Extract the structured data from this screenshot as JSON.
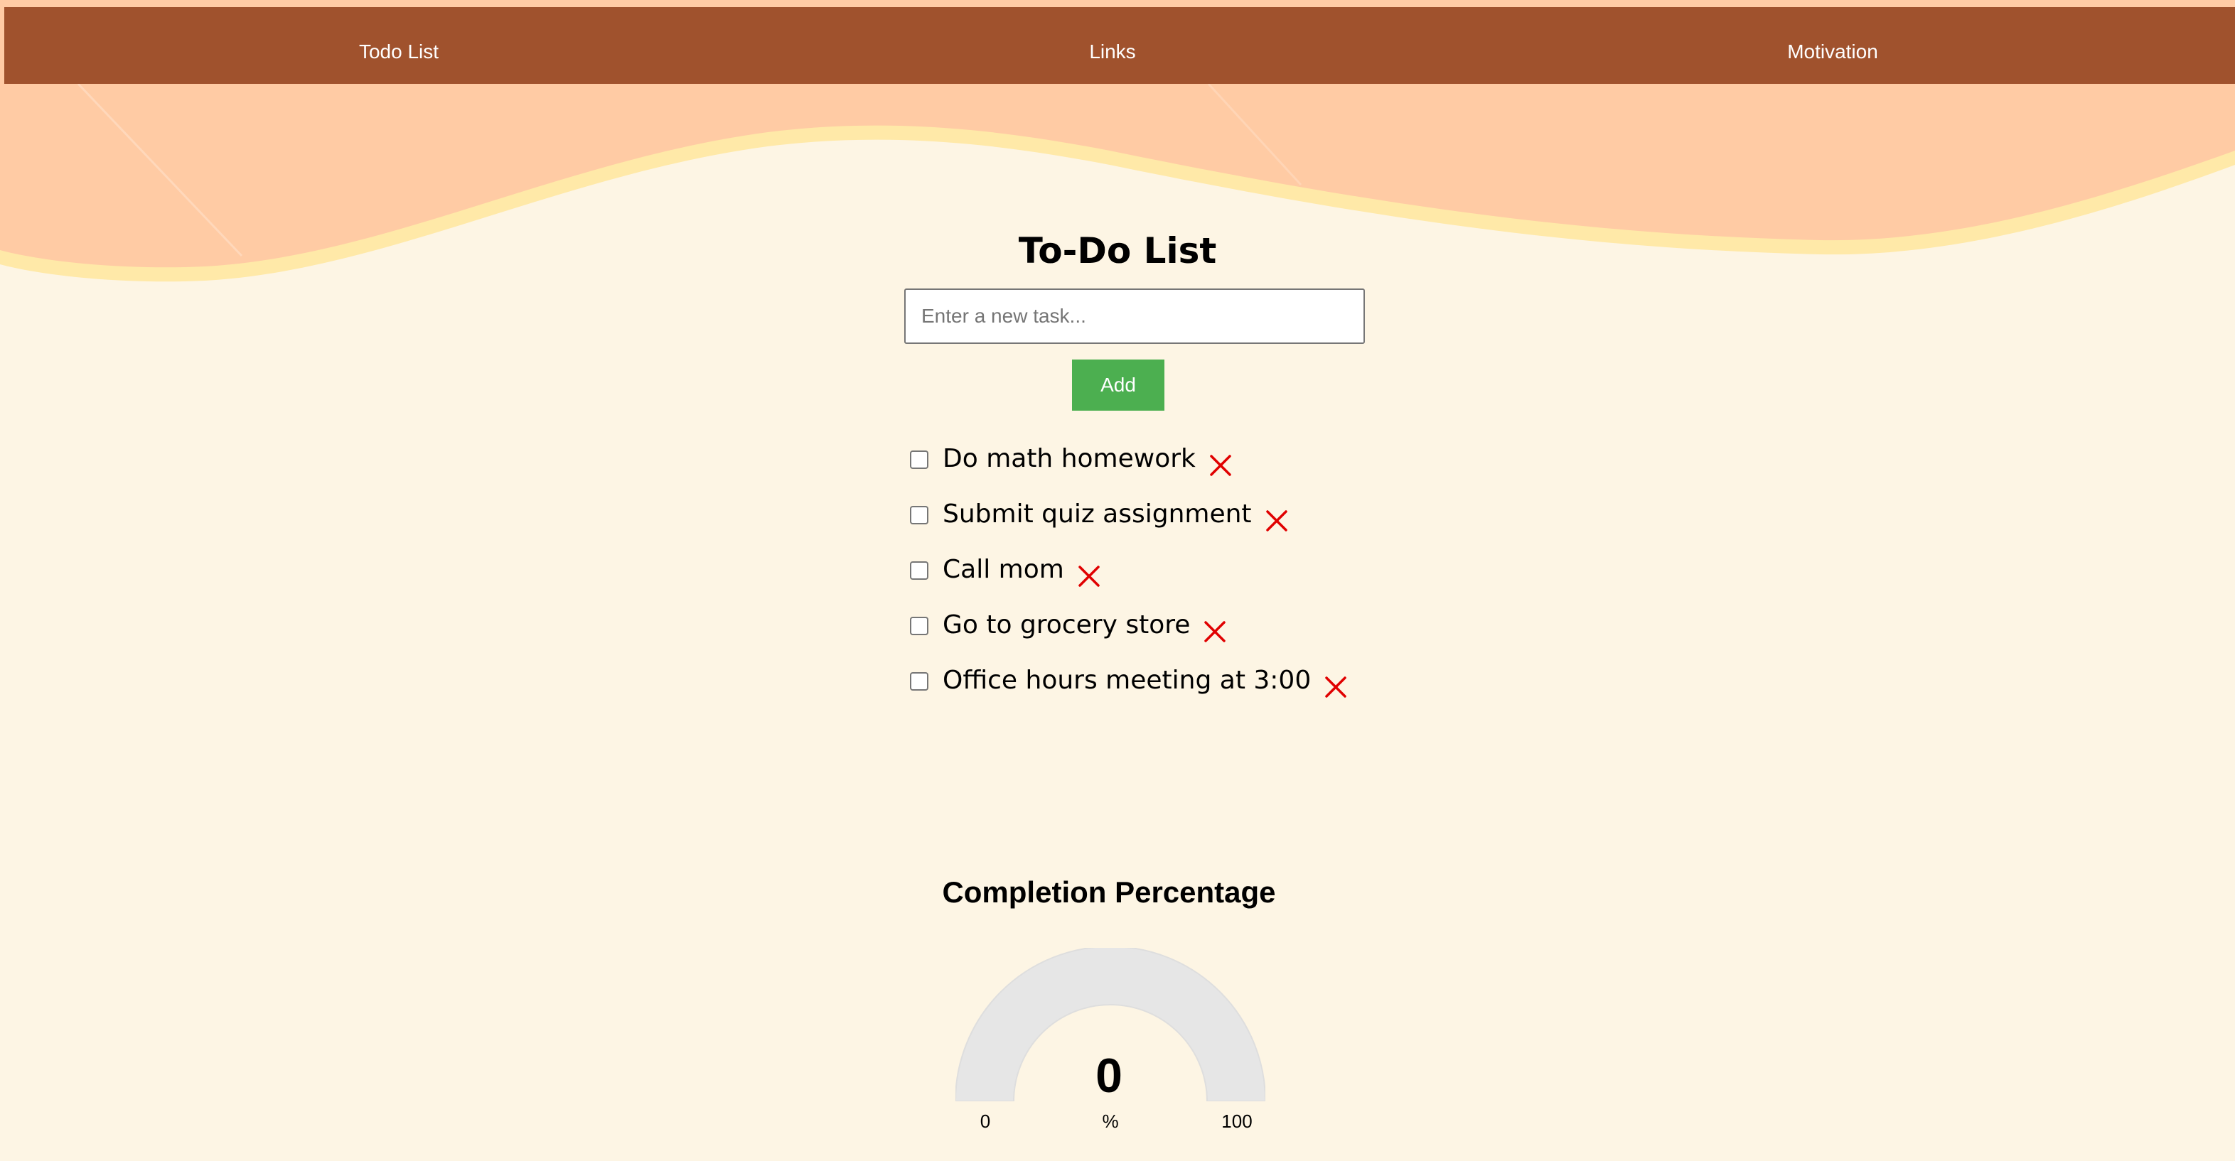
{
  "nav": {
    "items": [
      {
        "label": "Todo List"
      },
      {
        "label": "Links"
      },
      {
        "label": "Motivation"
      }
    ]
  },
  "todo": {
    "title": "To-Do List",
    "input_placeholder": "Enter a new task...",
    "input_value": "",
    "add_label": "Add",
    "tasks": [
      {
        "text": "Do math homework",
        "checked": false
      },
      {
        "text": "Submit quiz assignment",
        "checked": false
      },
      {
        "text": "Call mom",
        "checked": false
      },
      {
        "text": "Go to grocery store",
        "checked": false
      },
      {
        "text": "Office hours meeting at 3:00",
        "checked": false
      }
    ]
  },
  "completion": {
    "title": "Completion Percentage",
    "value": "0",
    "min": "0",
    "max": "100",
    "unit": "%"
  },
  "colors": {
    "nav_background": "#a0522d",
    "page_background": "#fdf5e4",
    "wave_peach": "#ffcba4",
    "wave_edge": "#ffe9a8",
    "add_button": "#4caf50",
    "delete_icon": "#e00000",
    "gauge_track": "#e6e6e6"
  }
}
